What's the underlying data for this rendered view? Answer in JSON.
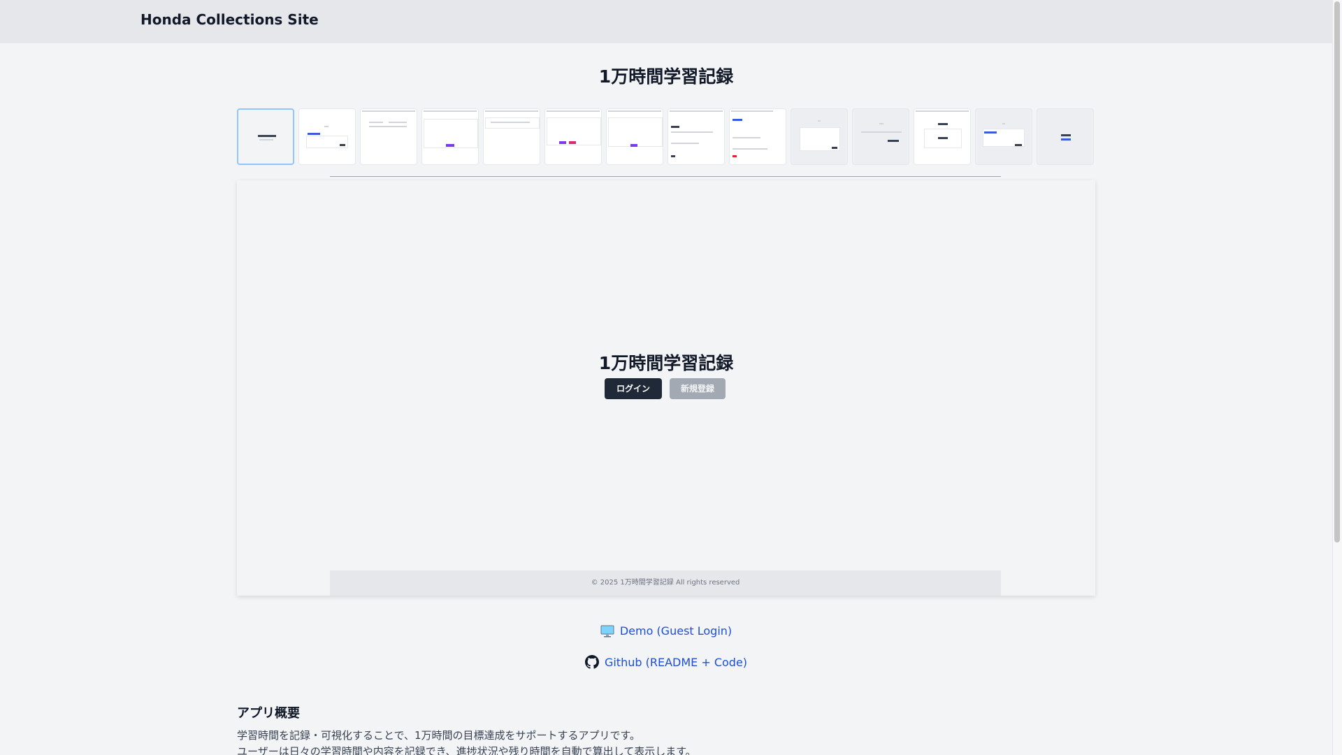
{
  "header": {
    "site_title": "Honda Collections Site"
  },
  "page": {
    "title": "1万時間学習記録"
  },
  "preview": {
    "title": "1万時間学習記録",
    "login_label": "ログイン",
    "register_label": "新規登録",
    "footer": "© 2025 1万時間学習記録 All rights reserved"
  },
  "links": {
    "demo": "Demo (Guest Login)",
    "github": "Github (README + Code)"
  },
  "overview": {
    "title": "アプリ概要",
    "line1": "学習時間を記録・可視化することで、1万時間の目標達成をサポートするアプリです。",
    "line2": "ユーザーは日々の学習時間や内容を記録でき、進捗状況や残り時間を自動で算出して表示します。"
  },
  "colors": {
    "accent": "#1d4ed8",
    "dark_button": "#1f2937",
    "header_bg": "#e5e7eb"
  },
  "icons": {
    "demo": "monitor-icon",
    "github": "github-icon"
  }
}
